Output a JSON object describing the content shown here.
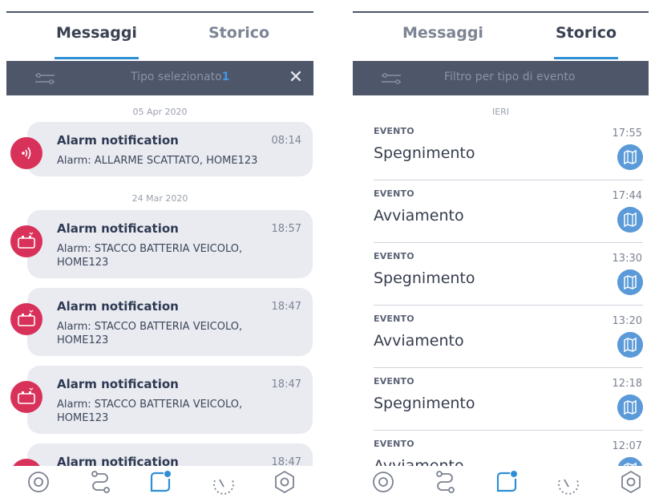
{
  "left": {
    "tabs": [
      {
        "label": "Messaggi",
        "active": true
      },
      {
        "label": "Storico",
        "active": false
      }
    ],
    "filter": {
      "text": "Tipo selezionato",
      "count": "1"
    },
    "dates": [
      "05 Apr 2020",
      "24 Mar 2020"
    ],
    "messages": [
      {
        "title": "Alarm notification",
        "time": "08:14",
        "body": "Alarm: ALLARME SCATTATO, HOME123",
        "icon": "signal-icon"
      },
      {
        "title": "Alarm notification",
        "time": "18:57",
        "body": "Alarm: STACCO BATTERIA VEICOLO, HOME123",
        "icon": "battery-icon"
      },
      {
        "title": "Alarm notification",
        "time": "18:47",
        "body": "Alarm: STACCO BATTERIA VEICOLO, HOME123",
        "icon": "battery-icon"
      },
      {
        "title": "Alarm notification",
        "time": "18:47",
        "body": "Alarm: STACCO BATTERIA VEICOLO, HOME123",
        "icon": "battery-icon"
      },
      {
        "title": "Alarm notification",
        "time": "18:47",
        "body": "",
        "icon": "battery-icon"
      }
    ]
  },
  "right": {
    "tabs": [
      {
        "label": "Messaggi",
        "active": false
      },
      {
        "label": "Storico",
        "active": true
      }
    ],
    "filter": {
      "text": "Filtro per tipo di evento"
    },
    "section": "IERI",
    "events": [
      {
        "category": "EVENTO",
        "name": "Spegnimento",
        "time": "17:55"
      },
      {
        "category": "EVENTO",
        "name": "Avviamento",
        "time": "17:44"
      },
      {
        "category": "EVENTO",
        "name": "Spegnimento",
        "time": "13:30"
      },
      {
        "category": "EVENTO",
        "name": "Avviamento",
        "time": "13:20"
      },
      {
        "category": "EVENTO",
        "name": "Spegnimento",
        "time": "12:18"
      },
      {
        "category": "EVENTO",
        "name": "Avviamento",
        "time": "12:07"
      }
    ]
  },
  "nav": [
    "home-icon",
    "route-icon",
    "messages-icon",
    "speed-icon",
    "settings-icon"
  ],
  "colors": {
    "accent": "#2f8fd6",
    "alarm": "#d9325a",
    "bar": "#4e566a",
    "card": "#e9ebf1",
    "map": "#5a9ad8",
    "nav": "#7b8190"
  }
}
